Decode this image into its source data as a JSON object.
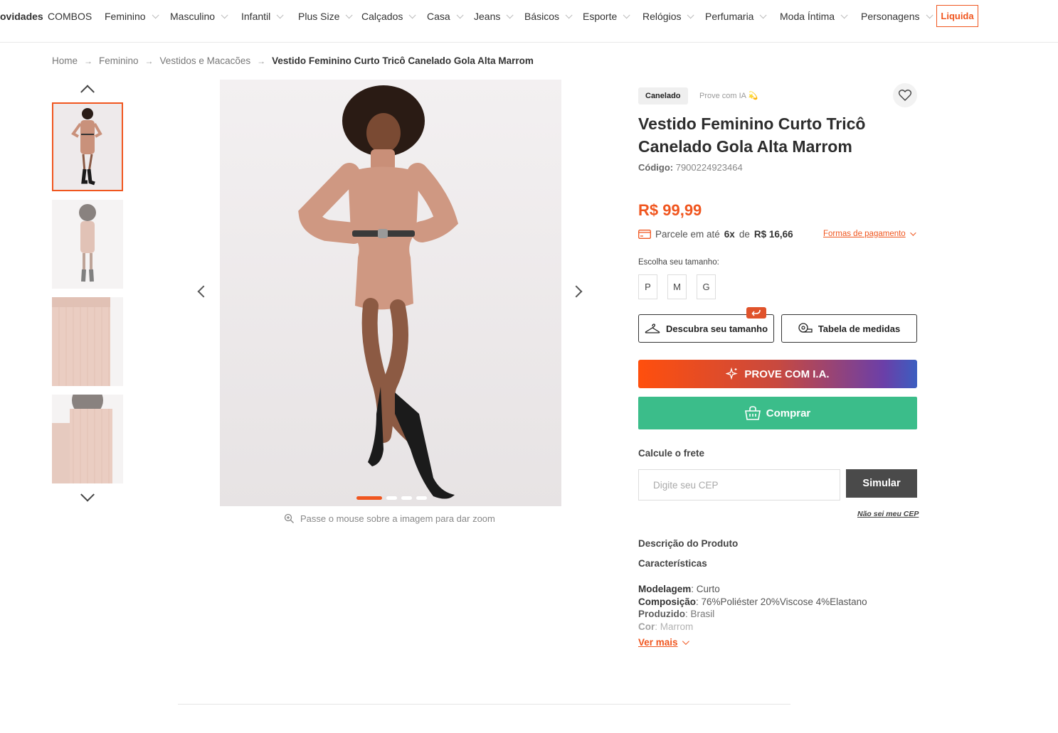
{
  "nav": {
    "items": [
      {
        "label": "ovidades",
        "bold": true,
        "chevron": false
      },
      {
        "label": "COMBOS",
        "bold": false,
        "chevron": false
      },
      {
        "label": "Feminino",
        "chevron": true
      },
      {
        "label": "Masculino",
        "chevron": true
      },
      {
        "label": "Infantil",
        "chevron": true
      },
      {
        "label": "Plus Size",
        "chevron": true
      },
      {
        "label": "Calçados",
        "chevron": true
      },
      {
        "label": "Casa",
        "chevron": true
      },
      {
        "label": "Jeans",
        "chevron": true
      },
      {
        "label": "Básicos",
        "chevron": true
      },
      {
        "label": "Esporte",
        "chevron": true
      },
      {
        "label": "Relógios",
        "chevron": true
      },
      {
        "label": "Perfumaria",
        "chevron": true
      },
      {
        "label": "Moda Íntima",
        "chevron": true
      },
      {
        "label": "Personagens",
        "chevron": true
      }
    ],
    "sale_label": "Liquida"
  },
  "breadcrumb": {
    "home": "Home",
    "level1": "Feminino",
    "level2": "Vestidos e Macacões",
    "current": "Vestido Feminino Curto Tricô Canelado Gola Alta Marrom"
  },
  "gallery": {
    "thumbnails": [
      "front-full",
      "back-full",
      "skirt-detail",
      "sleeve-detail"
    ],
    "active_index": 0,
    "dots": 4,
    "zoom_hint": "Passe o mouse sobre a imagem para dar zoom"
  },
  "product": {
    "badge": "Canelado",
    "try_ia": "Prove com IA 💫",
    "title": "Vestido Feminino Curto Tricô Canelado Gola Alta Marrom",
    "code_label": "Código:",
    "code_value": "7900224923464",
    "price": "R$ 99,99",
    "installment_prefix": "Parcele em até",
    "installment_count": "6x",
    "installment_mid": "de",
    "installment_value": "R$ 16,66",
    "payment_link": "Formas de pagamento",
    "size_label": "Escolha seu tamanho:",
    "sizes": [
      "P",
      "M",
      "G"
    ],
    "discover_size": "Descubra seu tamanho",
    "size_table": "Tabela de medidas",
    "try_ia_button": "PROVE COM I.A.",
    "buy_button": "Comprar"
  },
  "shipping": {
    "title": "Calcule o frete",
    "placeholder": "Digite seu CEP",
    "button": "Simular",
    "help": "Não sei meu CEP"
  },
  "description": {
    "title": "Descrição do Produto",
    "subtitle": "Características",
    "specs": [
      {
        "key": "Modelagem",
        "value": ": Curto"
      },
      {
        "key": "Composição",
        "value": ": 76%Poliéster 20%Viscose 4%Elastano"
      },
      {
        "key": "Produzido",
        "value": ": Brasil"
      },
      {
        "key": "Cor",
        "value": ": Marrom"
      }
    ],
    "more": "Ver mais"
  },
  "colors": {
    "accent": "#f0561f",
    "buy": "#3bbd8a",
    "dark_button": "#4a4a4a"
  }
}
